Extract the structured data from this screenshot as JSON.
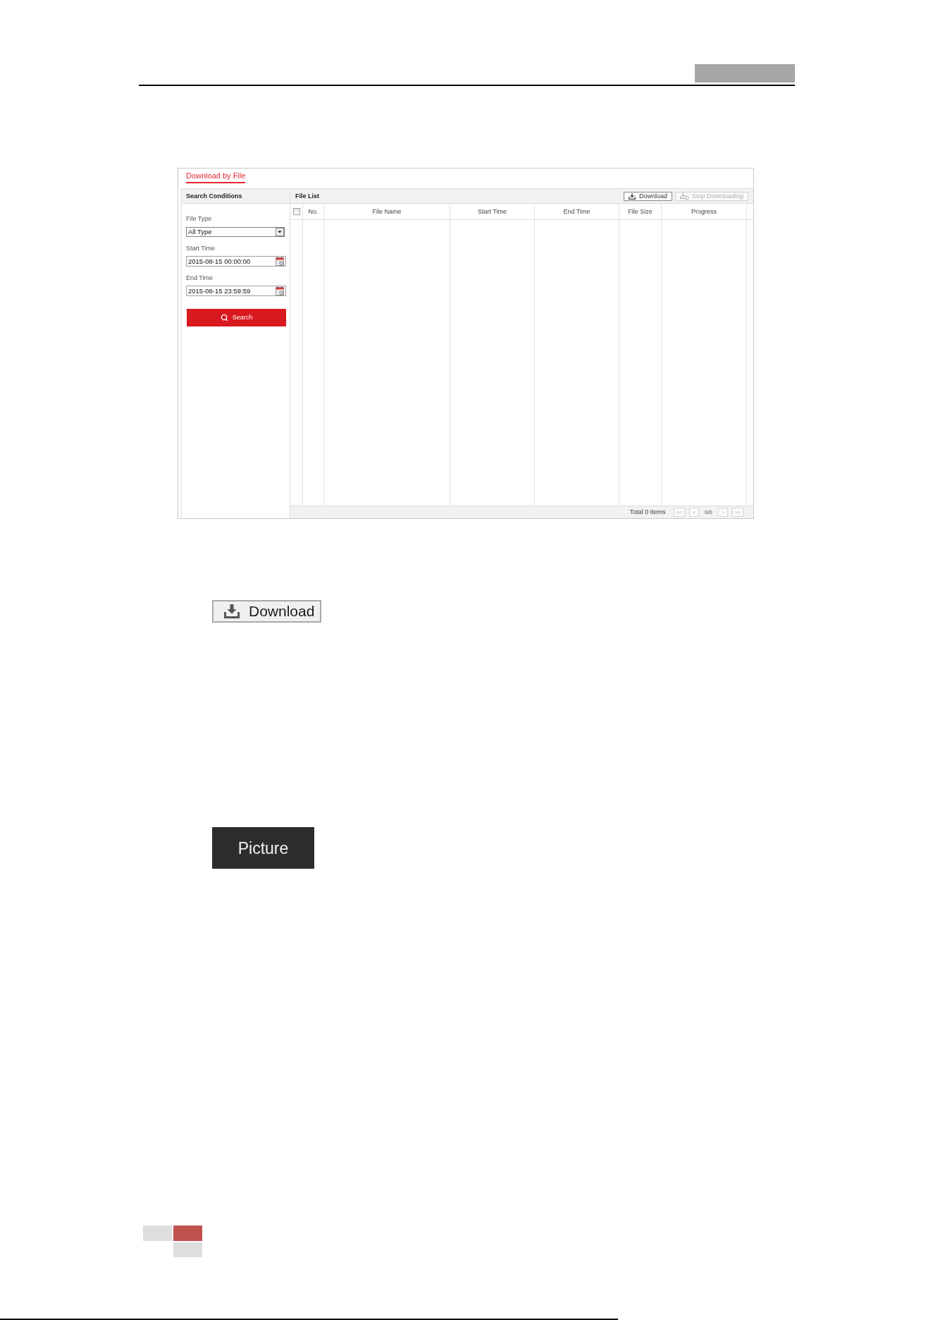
{
  "panel": {
    "tabs": [
      {
        "label": "Download by File",
        "selected": true
      }
    ],
    "search_conditions": {
      "title": "Search Conditions",
      "fields": [
        {
          "kind": "select",
          "label": "File Type",
          "value": "All Type"
        },
        {
          "kind": "datetime",
          "label": "Start Time",
          "value": "2015-08-15 00:00:00"
        },
        {
          "kind": "datetime",
          "label": "End Time",
          "value": "2015-08-15 23:59:59"
        }
      ],
      "search_button": "Search"
    },
    "file_list": {
      "title": "File List",
      "buttons": [
        {
          "kind": "download",
          "label": "Download",
          "disabled": false
        },
        {
          "kind": "stop",
          "label": "Stop Downloading",
          "disabled": true
        }
      ],
      "select_all": {
        "checked": false
      },
      "columns": [
        "No.",
        "File Name",
        "Start Time",
        "End Time",
        "File Size",
        "Progress"
      ],
      "total": "Total 0 Items",
      "pager": [
        {
          "kind": "button",
          "label": "<<",
          "disabled": true
        },
        {
          "kind": "button",
          "label": "<",
          "disabled": true
        },
        {
          "kind": "text",
          "label": "0/0"
        },
        {
          "kind": "button",
          "label": ">",
          "disabled": true
        },
        {
          "kind": "button",
          "label": ">>",
          "disabled": true
        }
      ]
    }
  },
  "examples": [
    {
      "kind": "download_button",
      "label": "Download"
    },
    {
      "kind": "picture_button",
      "label": "Picture"
    }
  ]
}
